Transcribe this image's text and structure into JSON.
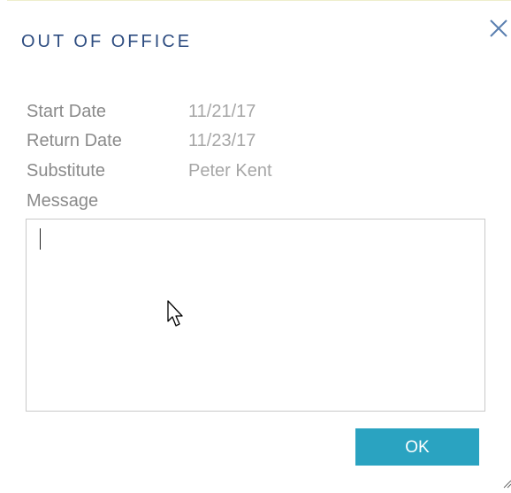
{
  "dialog": {
    "title": "OUT OF OFFICE",
    "fields": {
      "start_date_label": "Start Date",
      "start_date_value": "11/21/17",
      "return_date_label": "Return Date",
      "return_date_value": "11/23/17",
      "substitute_label": "Substitute",
      "substitute_value": "Peter Kent",
      "message_label": "Message"
    },
    "message_value": "",
    "ok_label": "OK"
  },
  "colors": {
    "title": "#2d4c80",
    "label": "#8a8a8a",
    "value": "#a6a6a6",
    "ok_button": "#2aa3c1"
  },
  "icons": {
    "close": "close-icon",
    "cursor": "mouse-pointer-icon",
    "resize": "resize-grip-icon"
  }
}
